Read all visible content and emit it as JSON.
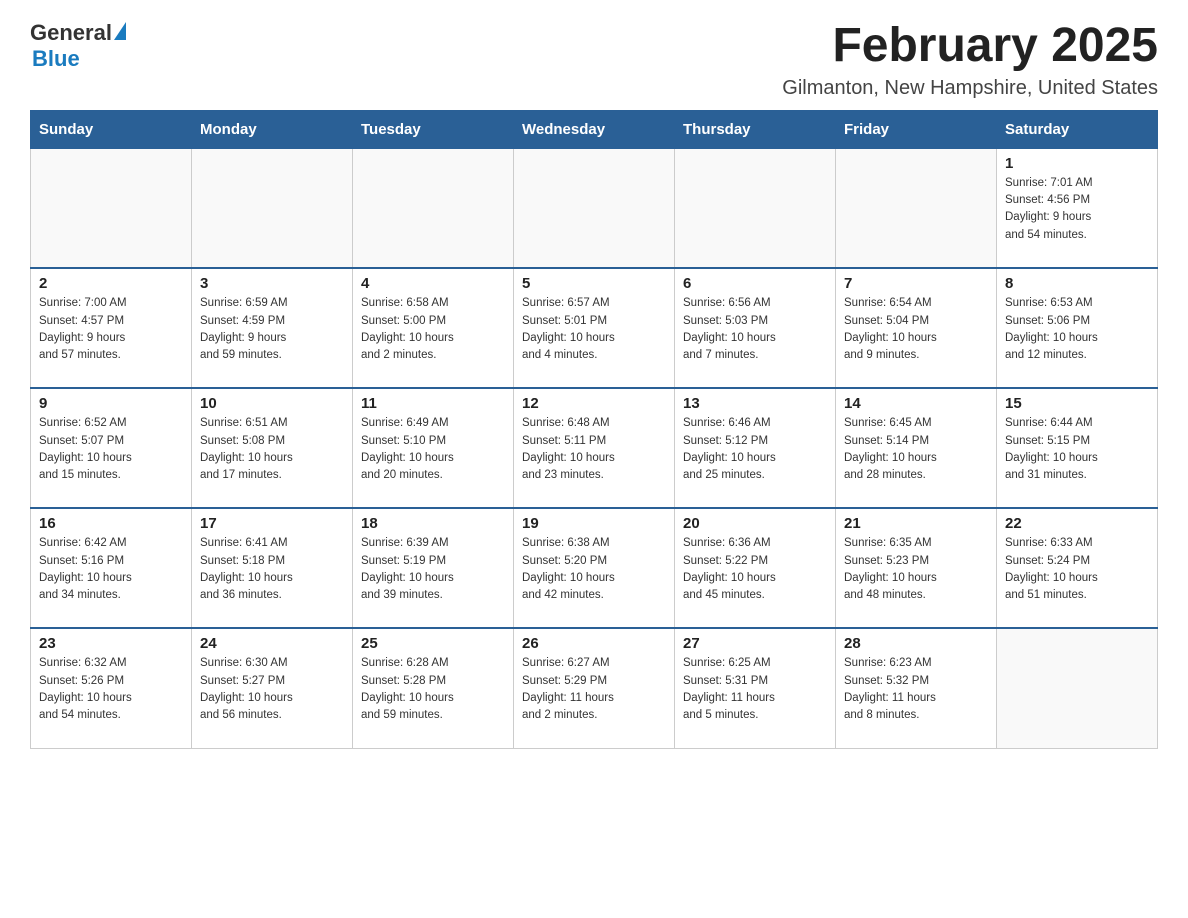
{
  "header": {
    "logo_general": "General",
    "logo_blue": "Blue",
    "month_year": "February 2025",
    "location": "Gilmanton, New Hampshire, United States"
  },
  "days_of_week": [
    "Sunday",
    "Monday",
    "Tuesday",
    "Wednesday",
    "Thursday",
    "Friday",
    "Saturday"
  ],
  "weeks": [
    [
      {
        "day": "",
        "info": ""
      },
      {
        "day": "",
        "info": ""
      },
      {
        "day": "",
        "info": ""
      },
      {
        "day": "",
        "info": ""
      },
      {
        "day": "",
        "info": ""
      },
      {
        "day": "",
        "info": ""
      },
      {
        "day": "1",
        "info": "Sunrise: 7:01 AM\nSunset: 4:56 PM\nDaylight: 9 hours\nand 54 minutes."
      }
    ],
    [
      {
        "day": "2",
        "info": "Sunrise: 7:00 AM\nSunset: 4:57 PM\nDaylight: 9 hours\nand 57 minutes."
      },
      {
        "day": "3",
        "info": "Sunrise: 6:59 AM\nSunset: 4:59 PM\nDaylight: 9 hours\nand 59 minutes."
      },
      {
        "day": "4",
        "info": "Sunrise: 6:58 AM\nSunset: 5:00 PM\nDaylight: 10 hours\nand 2 minutes."
      },
      {
        "day": "5",
        "info": "Sunrise: 6:57 AM\nSunset: 5:01 PM\nDaylight: 10 hours\nand 4 minutes."
      },
      {
        "day": "6",
        "info": "Sunrise: 6:56 AM\nSunset: 5:03 PM\nDaylight: 10 hours\nand 7 minutes."
      },
      {
        "day": "7",
        "info": "Sunrise: 6:54 AM\nSunset: 5:04 PM\nDaylight: 10 hours\nand 9 minutes."
      },
      {
        "day": "8",
        "info": "Sunrise: 6:53 AM\nSunset: 5:06 PM\nDaylight: 10 hours\nand 12 minutes."
      }
    ],
    [
      {
        "day": "9",
        "info": "Sunrise: 6:52 AM\nSunset: 5:07 PM\nDaylight: 10 hours\nand 15 minutes."
      },
      {
        "day": "10",
        "info": "Sunrise: 6:51 AM\nSunset: 5:08 PM\nDaylight: 10 hours\nand 17 minutes."
      },
      {
        "day": "11",
        "info": "Sunrise: 6:49 AM\nSunset: 5:10 PM\nDaylight: 10 hours\nand 20 minutes."
      },
      {
        "day": "12",
        "info": "Sunrise: 6:48 AM\nSunset: 5:11 PM\nDaylight: 10 hours\nand 23 minutes."
      },
      {
        "day": "13",
        "info": "Sunrise: 6:46 AM\nSunset: 5:12 PM\nDaylight: 10 hours\nand 25 minutes."
      },
      {
        "day": "14",
        "info": "Sunrise: 6:45 AM\nSunset: 5:14 PM\nDaylight: 10 hours\nand 28 minutes."
      },
      {
        "day": "15",
        "info": "Sunrise: 6:44 AM\nSunset: 5:15 PM\nDaylight: 10 hours\nand 31 minutes."
      }
    ],
    [
      {
        "day": "16",
        "info": "Sunrise: 6:42 AM\nSunset: 5:16 PM\nDaylight: 10 hours\nand 34 minutes."
      },
      {
        "day": "17",
        "info": "Sunrise: 6:41 AM\nSunset: 5:18 PM\nDaylight: 10 hours\nand 36 minutes."
      },
      {
        "day": "18",
        "info": "Sunrise: 6:39 AM\nSunset: 5:19 PM\nDaylight: 10 hours\nand 39 minutes."
      },
      {
        "day": "19",
        "info": "Sunrise: 6:38 AM\nSunset: 5:20 PM\nDaylight: 10 hours\nand 42 minutes."
      },
      {
        "day": "20",
        "info": "Sunrise: 6:36 AM\nSunset: 5:22 PM\nDaylight: 10 hours\nand 45 minutes."
      },
      {
        "day": "21",
        "info": "Sunrise: 6:35 AM\nSunset: 5:23 PM\nDaylight: 10 hours\nand 48 minutes."
      },
      {
        "day": "22",
        "info": "Sunrise: 6:33 AM\nSunset: 5:24 PM\nDaylight: 10 hours\nand 51 minutes."
      }
    ],
    [
      {
        "day": "23",
        "info": "Sunrise: 6:32 AM\nSunset: 5:26 PM\nDaylight: 10 hours\nand 54 minutes."
      },
      {
        "day": "24",
        "info": "Sunrise: 6:30 AM\nSunset: 5:27 PM\nDaylight: 10 hours\nand 56 minutes."
      },
      {
        "day": "25",
        "info": "Sunrise: 6:28 AM\nSunset: 5:28 PM\nDaylight: 10 hours\nand 59 minutes."
      },
      {
        "day": "26",
        "info": "Sunrise: 6:27 AM\nSunset: 5:29 PM\nDaylight: 11 hours\nand 2 minutes."
      },
      {
        "day": "27",
        "info": "Sunrise: 6:25 AM\nSunset: 5:31 PM\nDaylight: 11 hours\nand 5 minutes."
      },
      {
        "day": "28",
        "info": "Sunrise: 6:23 AM\nSunset: 5:32 PM\nDaylight: 11 hours\nand 8 minutes."
      },
      {
        "day": "",
        "info": ""
      }
    ]
  ]
}
